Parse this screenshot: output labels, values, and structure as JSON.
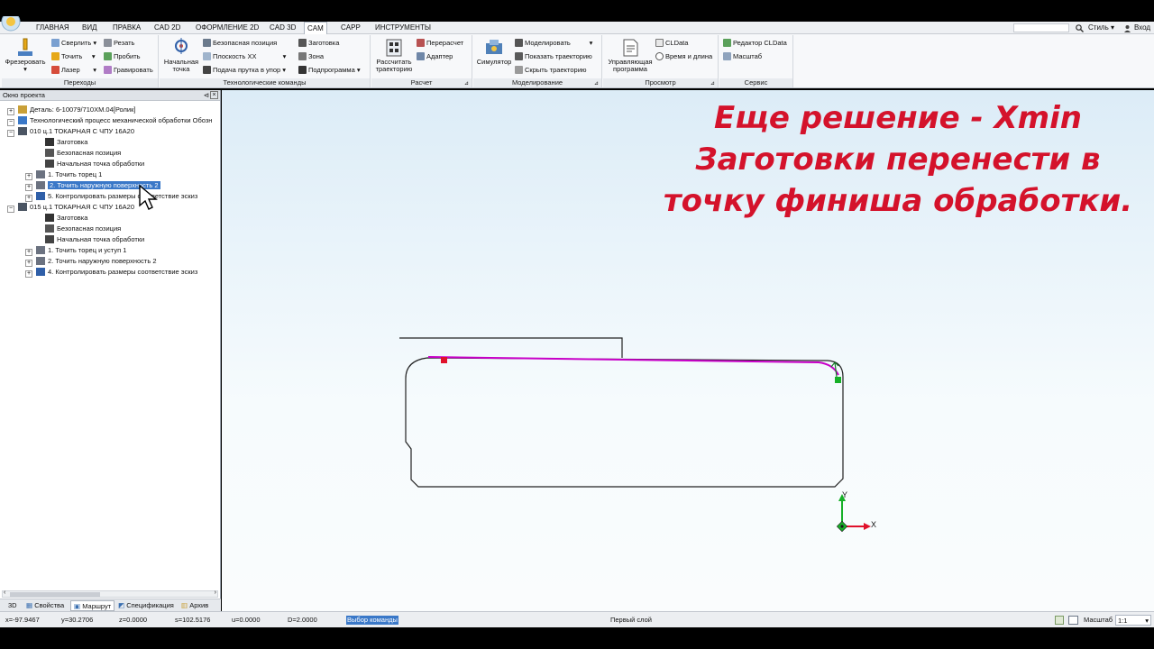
{
  "menu": {
    "items": [
      "ГЛАВНАЯ",
      "ВИД",
      "ПРАВКА",
      "CAD 2D",
      "ОФОРМЛЕНИЕ 2D",
      "CAD 3D",
      "CAM",
      "CAPP",
      "ИНСТРУМЕНТЫ"
    ],
    "active": "CAM",
    "style_label": "Стиль",
    "login_label": "Вход"
  },
  "ribbon": {
    "perehody": {
      "label": "Переходы",
      "frezer": "Фрезеровать",
      "sverlit": "Сверлить",
      "tochit": "Точить",
      "lazer": "Лазер",
      "rezat": "Резать",
      "probit": "Пробить",
      "gravirovat": "Гравировать"
    },
    "tech": {
      "label": "Технологические команды",
      "nach_tochka": "Начальная точка",
      "bezop": "Безопасная позиция",
      "ploskost": "Плоскость XX",
      "podacha": "Подача прутка в упор",
      "zagotovka": "Заготовка",
      "zona": "Зона",
      "podprogramma": "Подпрограмма"
    },
    "raschet": {
      "label": "Расчет",
      "rasschitat": "Рассчитать траекторию",
      "pereraschet": "Перерасчет",
      "adapter": "Адаптер"
    },
    "model": {
      "label": "Моделирование",
      "simulator": "Симулятор",
      "modelirovat": "Моделировать",
      "pokazat": "Показать траекторию",
      "skryt": "Скрыть траекторию"
    },
    "prosmotr": {
      "label": "Просмотр",
      "upravl": "Управляющая программа",
      "cldata": "CLData",
      "vremya": "Время и длина"
    },
    "servis": {
      "label": "Сервис",
      "redaktor": "Редактор CLData",
      "masshtab": "Масштаб"
    }
  },
  "project_panel": {
    "title": "Окно проекта",
    "nodes": [
      {
        "text": "Деталь: 6-10079/710ХМ.04[Ролик]",
        "level": 0,
        "toggle": "+",
        "icon": "detail"
      },
      {
        "text": "Технологический процесс механической обработки Обозн",
        "level": 0,
        "toggle": "−",
        "icon": "process"
      },
      {
        "text": "010 ц.1 ТОКАРНАЯ С ЧПУ 16А20",
        "level": 1,
        "toggle": "−",
        "icon": "lathe"
      },
      {
        "text": "Заготовка",
        "level": 3,
        "toggle": "",
        "icon": "blank"
      },
      {
        "text": "Безопасная позиция",
        "level": 3,
        "toggle": "",
        "icon": "safe"
      },
      {
        "text": "Начальная точка обработки",
        "level": 3,
        "toggle": "",
        "icon": "start"
      },
      {
        "text": "1.  Точить торец 1",
        "level": 2,
        "toggle": "+",
        "icon": "turn"
      },
      {
        "text": "2.  Точить наружную поверхность 2",
        "level": 2,
        "toggle": "+",
        "icon": "turn",
        "selected": true
      },
      {
        "text": "5.  Контролировать размеры соответствие эскиз",
        "level": 2,
        "toggle": "+",
        "icon": "control"
      },
      {
        "text": "015 ц.1 ТОКАРНАЯ С ЧПУ 16А20",
        "level": 1,
        "toggle": "−",
        "icon": "lathe"
      },
      {
        "text": "Заготовка",
        "level": 3,
        "toggle": "",
        "icon": "blank"
      },
      {
        "text": "Безопасная позиция",
        "level": 3,
        "toggle": "",
        "icon": "safe"
      },
      {
        "text": "Начальная точка обработки",
        "level": 3,
        "toggle": "",
        "icon": "start"
      },
      {
        "text": "1.  Точить торец и уступ 1",
        "level": 2,
        "toggle": "+",
        "icon": "turn"
      },
      {
        "text": "2.  Точить наружную поверхность 2",
        "level": 2,
        "toggle": "+",
        "icon": "turn"
      },
      {
        "text": "4.  Контролировать размеры соответствие эскиз",
        "level": 2,
        "toggle": "+",
        "icon": "control"
      }
    ],
    "tabs": [
      "3D",
      "Свойства",
      "Маршрут",
      "Спецификация",
      "Архив"
    ],
    "active_tab": "Маршрут"
  },
  "overlay_text": {
    "line1": "Еще решение - Xmin",
    "line2": "Заготовки перенести в",
    "line3": "точку финиша обработки."
  },
  "axes": {
    "x": "X",
    "y": "Y"
  },
  "status": {
    "x": "x=-97.9467",
    "y": "y=30.2706",
    "z": "z=0.0000",
    "s": "s=102.5176",
    "u": "u=0.0000",
    "d": "D=2.0000",
    "mode": "Выбор команды",
    "layer": "Первый слой",
    "scale_label": "Масштаб",
    "scale_value": "1:1"
  },
  "colors": {
    "overlay": "#d4122b",
    "toolpath": "#c800c8",
    "selection": "#3a78c8"
  }
}
